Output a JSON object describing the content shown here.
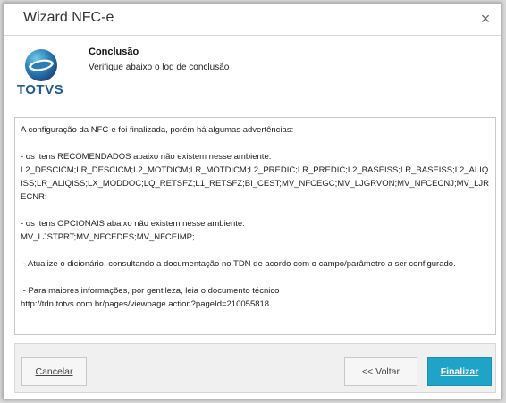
{
  "window": {
    "title": "Wizard NFC-e",
    "close_label": "×"
  },
  "header": {
    "logo_text": "TOTVS",
    "title": "Conclusão",
    "subtitle": "Verifique abaixo o log de conclusão"
  },
  "log": {
    "lines": [
      "A configuração da NFC-e foi finalizada, porém há algumas advertências:",
      "",
      "- os itens RECOMENDADOS abaixo não existem nesse ambiente:",
      "L2_DESCICM;LR_DESCICM;L2_MOTDICM;LR_MOTDICM;L2_PREDIC;LR_PREDIC;L2_BASEISS;LR_BASEISS;L2_ALIQISS;LR_ALIQISS;LX_MODDOC;LQ_RETSFZ;L1_RETSFZ;BI_CEST;MV_NFCEGC;MV_LJGRVON;MV_NFCECNJ;MV_LJRECNR;",
      "",
      "- os itens OPCIONAIS abaixo não existem nesse ambiente:",
      "MV_LJSTPRT;MV_NFCEDES;MV_NFCEIMP;",
      "",
      " - Atualize o dicionário, consultando a documentação no TDN de acordo com o campo/parâmetro a ser configurado.",
      "",
      " - Para maiores informações, por gentileza, leia o documento técnico",
      "http://tdn.totvs.com.br/pages/viewpage.action?pageId=210055818."
    ]
  },
  "buttons": {
    "cancel_label": "Cancelar",
    "back_label": "<< Voltar",
    "finish_label": "Finalizar"
  },
  "colors": {
    "accent": "#1fa3c9",
    "logo_blue": "#1f5a95"
  }
}
